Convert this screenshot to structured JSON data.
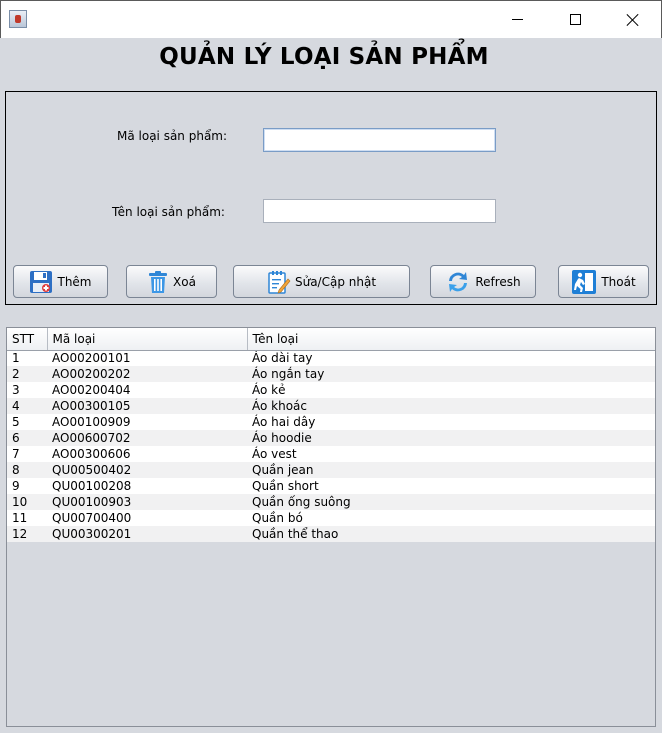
{
  "window": {
    "icons": {
      "app": "java-app-icon",
      "minimize": "minimize-icon",
      "maximize": "maximize-icon",
      "close": "close-icon"
    }
  },
  "title": "QUẢN LÝ LOẠI SẢN PHẨM",
  "form": {
    "code_label": "Mã loại sản phẩm:",
    "code_value": "",
    "name_label": "Tên loại sản phẩm:",
    "name_value": ""
  },
  "buttons": {
    "add": "Thêm",
    "delete": "Xoá",
    "edit": "Sửa/Cập nhật",
    "refresh": "Refresh",
    "exit": "Thoát"
  },
  "colors": {
    "background": "#d6d9df",
    "accent_blue": "#2f7fd8",
    "focus_border": "#7a9cc6"
  },
  "table": {
    "headers": [
      "STT",
      "Mã loại",
      "Tên loại"
    ],
    "rows": [
      [
        "1",
        "AO00200101",
        "Áo dài tay"
      ],
      [
        "2",
        "AO00200202",
        "Áo ngắn tay"
      ],
      [
        "3",
        "AO00200404",
        "Áo kẻ"
      ],
      [
        "4",
        "AO00300105",
        "Áo khoác"
      ],
      [
        "5",
        "AO00100909",
        "Áo hai dây"
      ],
      [
        "6",
        "AO00600702",
        "Áo hoodie"
      ],
      [
        "7",
        "AO00300606",
        "Áo vest"
      ],
      [
        "8",
        "QU00500402",
        "Quần jean"
      ],
      [
        "9",
        "QU00100208",
        "Quần short"
      ],
      [
        "10",
        "QU00100903",
        "Quần ống suông"
      ],
      [
        "11",
        "QU00700400",
        "Quần bó"
      ],
      [
        "12",
        "QU00300201",
        "Quần thể thao"
      ]
    ]
  }
}
